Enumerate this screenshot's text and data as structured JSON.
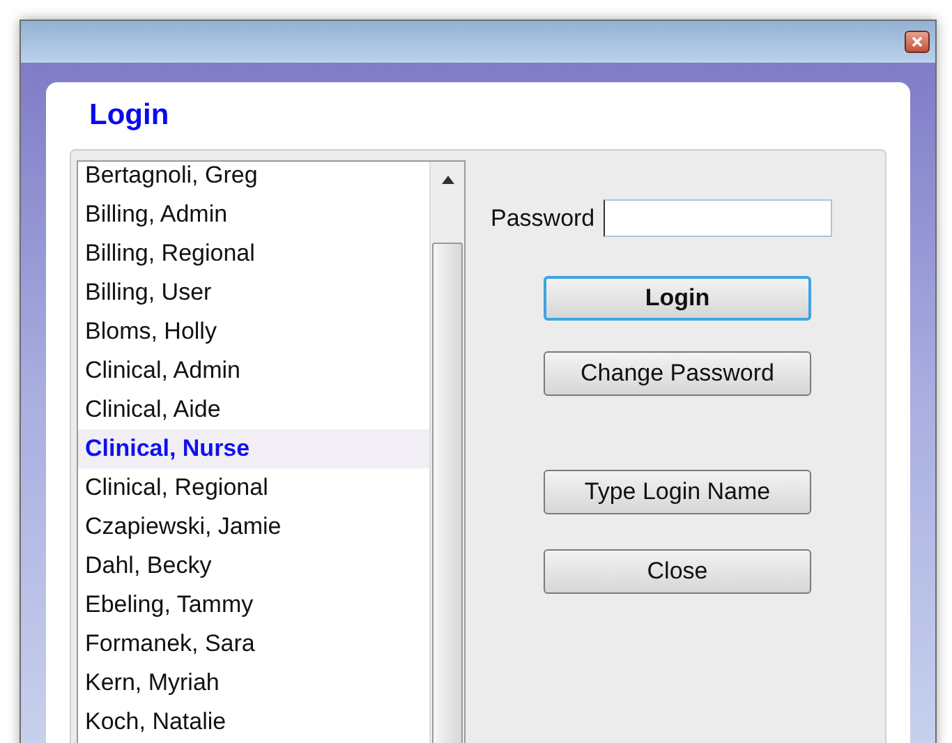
{
  "dialog": {
    "title": "Login"
  },
  "users": [
    {
      "name": "Bertagnoli, Greg",
      "selected": false
    },
    {
      "name": "Billing, Admin",
      "selected": false
    },
    {
      "name": "Billing, Regional",
      "selected": false
    },
    {
      "name": "Billing, User",
      "selected": false
    },
    {
      "name": "Bloms, Holly",
      "selected": false
    },
    {
      "name": "Clinical, Admin",
      "selected": false
    },
    {
      "name": "Clinical, Aide",
      "selected": false
    },
    {
      "name": "Clinical, Nurse",
      "selected": true
    },
    {
      "name": "Clinical, Regional",
      "selected": false
    },
    {
      "name": "Czapiewski, Jamie",
      "selected": false
    },
    {
      "name": "Dahl, Becky",
      "selected": false
    },
    {
      "name": "Ebeling, Tammy",
      "selected": false
    },
    {
      "name": "Formanek, Sara",
      "selected": false
    },
    {
      "name": "Kern, Myriah",
      "selected": false
    },
    {
      "name": "Koch, Natalie",
      "selected": false
    }
  ],
  "password": {
    "label": "Password"
  },
  "buttons": [
    {
      "label": "Login",
      "default": true
    },
    {
      "label": "Change Password",
      "default": false
    },
    {
      "label": "Type Login Name",
      "default": false
    },
    {
      "label": "Close",
      "default": false
    }
  ]
}
